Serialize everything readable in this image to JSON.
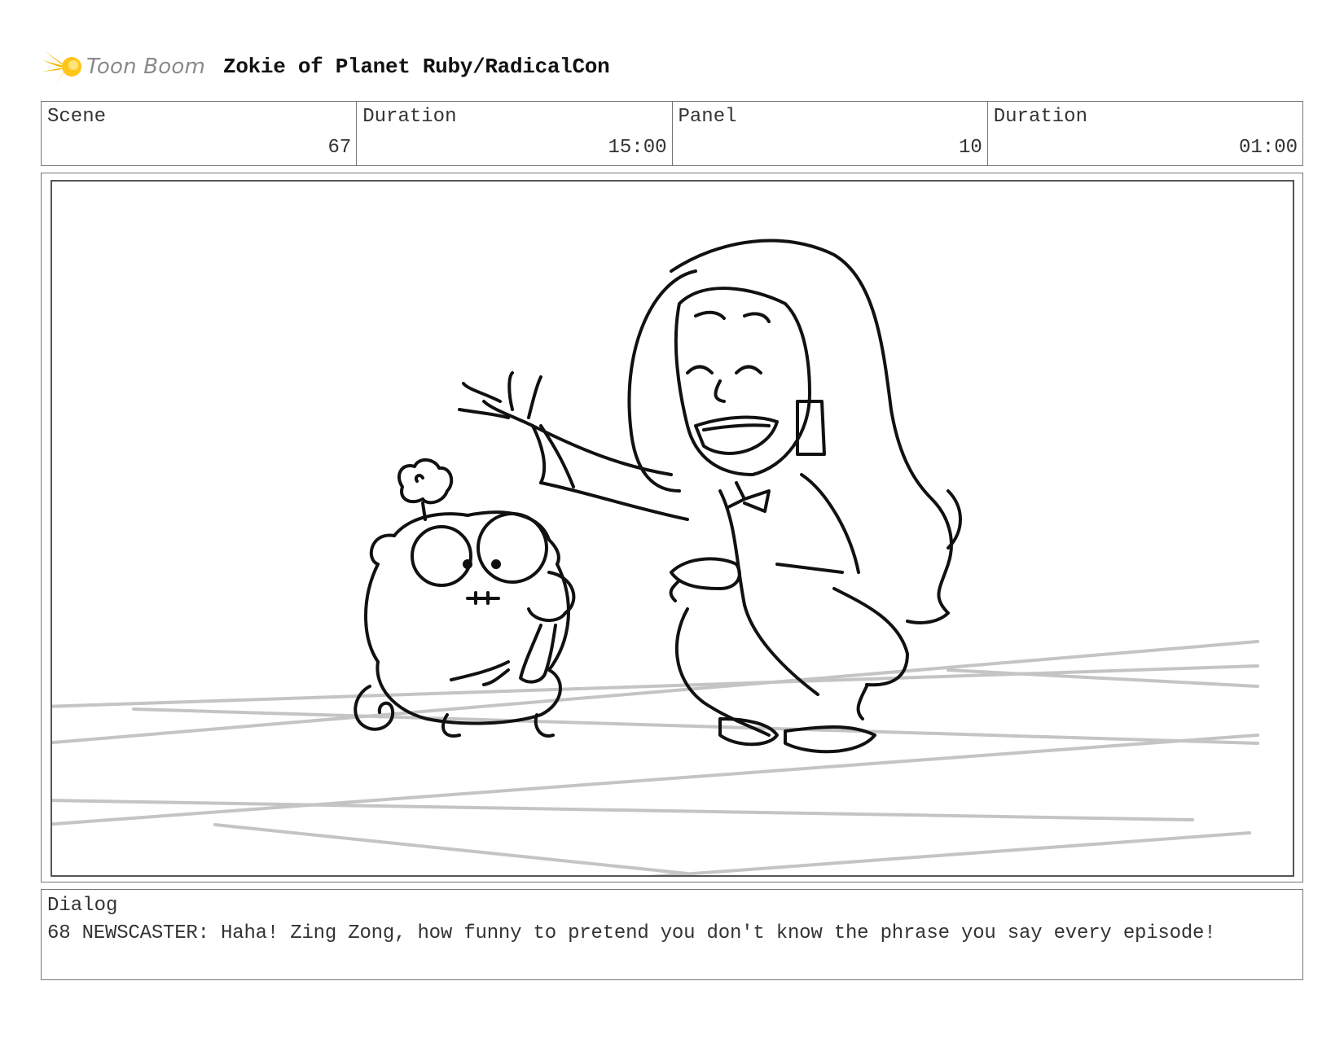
{
  "header": {
    "logo_name": "Toon Boom",
    "logo_icon": "starburst-logo-icon",
    "project_title": "Zokie of Planet Ruby/RadicalCon"
  },
  "info": {
    "scene_label": "Scene",
    "scene_value": "67",
    "scene_duration_label": "Duration",
    "scene_duration_value": "15:00",
    "panel_label": "Panel",
    "panel_value": "10",
    "panel_duration_label": "Duration",
    "panel_duration_value": "01:00"
  },
  "panel_image": {
    "description_icon": "storyboard-sketch-image",
    "accent_color": "#f5b800",
    "line_color": "#111111",
    "floor_line_color": "#c4c4c4"
  },
  "dialog": {
    "label": "Dialog",
    "text": "68 NEWSCASTER: Haha! Zing Zong, how funny to pretend you don't know the phrase you say every episode!"
  }
}
